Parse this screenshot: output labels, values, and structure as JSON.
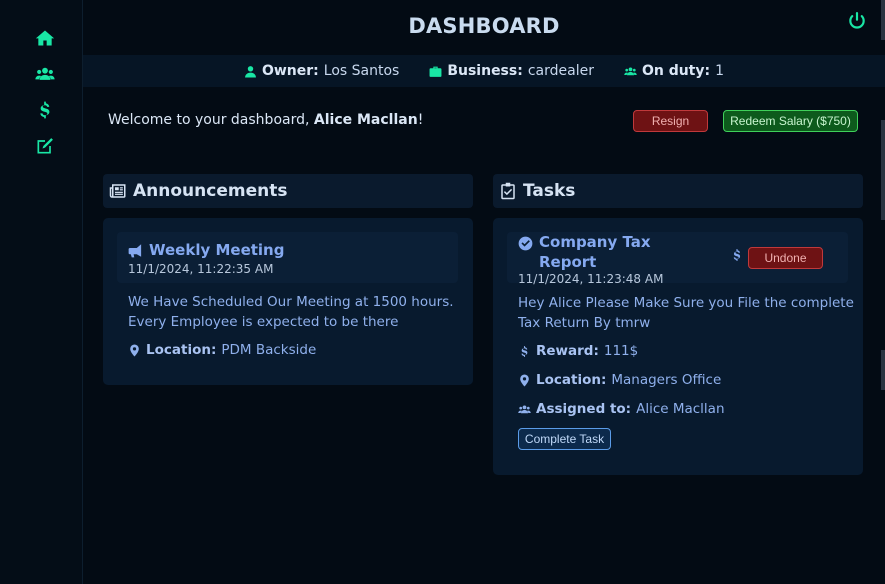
{
  "header": {
    "title": "DASHBOARD"
  },
  "sidebar": {
    "items": [
      {
        "icon": "home-icon"
      },
      {
        "icon": "users-icon"
      },
      {
        "icon": "dollar-icon"
      },
      {
        "icon": "edit-icon"
      }
    ]
  },
  "infobar": {
    "owner_label": "Owner:",
    "owner_value": "Los Santos",
    "business_label": "Business:",
    "business_value": "cardealer",
    "duty_label": "On duty:",
    "duty_value": "1"
  },
  "welcome": {
    "prefix": "Welcome to your dashboard, ",
    "name": "Alice Macllan",
    "suffix": "!"
  },
  "actions": {
    "resign": "Resign",
    "redeem": "Redeem Salary ($750)"
  },
  "announcements": {
    "title": "Announcements",
    "items": [
      {
        "title": "Weekly Meeting",
        "timestamp": "11/1/2024, 11:22:35 AM",
        "body_line1": "We Have Scheduled Our Meeting at 1500 hours.",
        "body_line2": "Every Employee is expected to be there",
        "location_label": "Location:",
        "location_value": "PDM Backside"
      }
    ]
  },
  "tasks": {
    "title": "Tasks",
    "items": [
      {
        "title_line1": "Company Tax",
        "title_line2": "Report",
        "timestamp": "11/1/2024, 11:23:48 AM",
        "status_button": "Undone",
        "body_line1": "Hey Alice Please Make Sure you File the complete",
        "body_line2": "Tax Return By tmrw",
        "reward_label": "Reward:",
        "reward_value": "111$",
        "location_label": "Location:",
        "location_value": "Managers Office",
        "assigned_label": "Assigned to:",
        "assigned_value": "Alice Macllan",
        "complete_button": "Complete Task"
      }
    ]
  },
  "colors": {
    "accent": "#19e6a5",
    "background": "#030b14",
    "danger": "#c0393b",
    "success": "#3fd05a",
    "link": "#85a9f0"
  }
}
